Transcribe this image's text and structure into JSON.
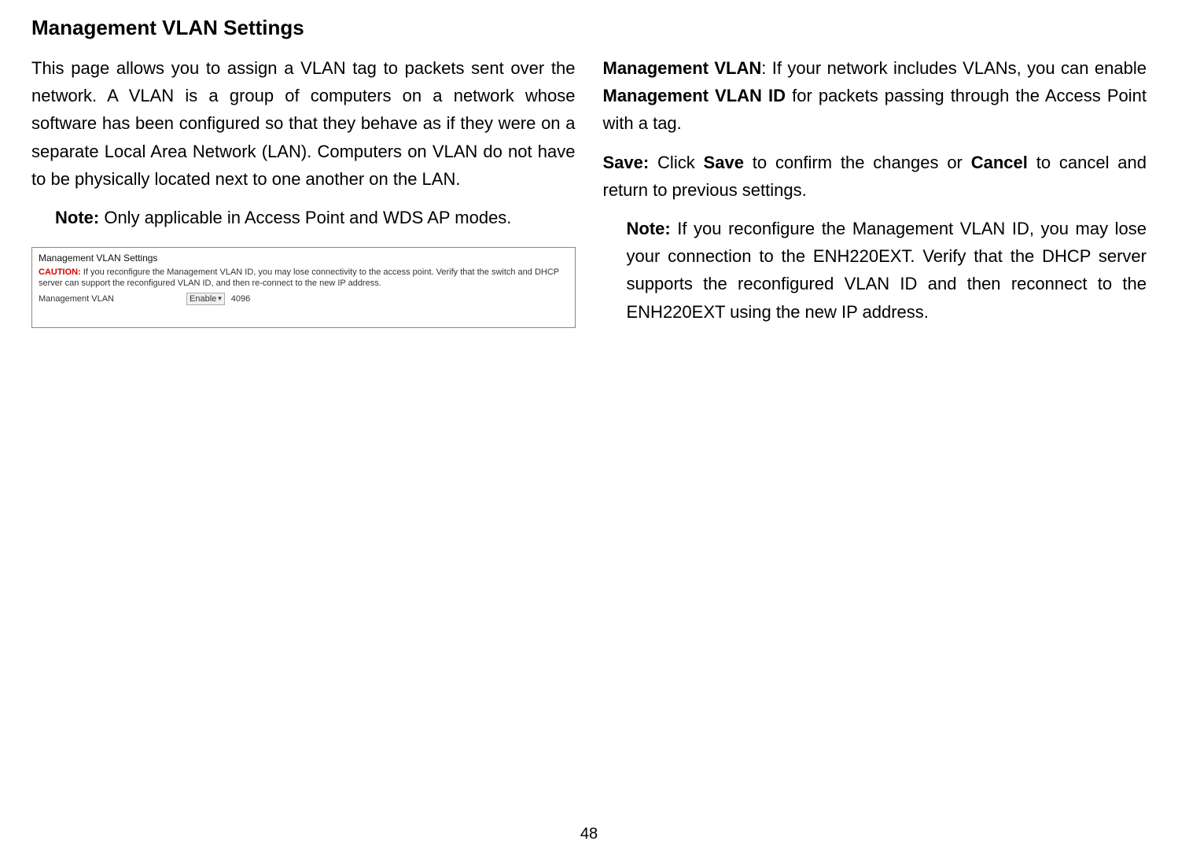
{
  "page": {
    "title": "Management VLAN Settings",
    "number": "48"
  },
  "left_col": {
    "intro": "This page allows you to assign a VLAN tag to packets sent over the network. A VLAN is a group of computers on a network whose software has been configured so that they behave as if they were on a separate Local Area Network (LAN). Computers on VLAN do not have to be physically located next to one another on the LAN.",
    "note_label": "Note:",
    "note_text": " Only applicable in Access Point and WDS AP modes."
  },
  "settings_box": {
    "title": "Management VLAN Settings",
    "caution_label": "CAUTION:",
    "caution_text": " If you reconfigure the Management VLAN ID, you may lose connectivity to the access point. Verify that the switch and DHCP server can support the reconfigured VLAN ID, and then re-connect to the new IP address.",
    "row_label": "Management VLAN",
    "dropdown_value": "Enable",
    "vlan_id": "4096"
  },
  "right_col": {
    "mgmt_label": "Management VLAN",
    "mgmt_text_1": ": If your network includes VLANs, you can enable ",
    "mgmt_bold": "Management VLAN ID",
    "mgmt_text_2": " for packets passing through the Access Point with a tag.",
    "save_label": "Save:",
    "save_text_1": " Click ",
    "save_bold_1": "Save",
    "save_text_2": " to confirm the changes or ",
    "save_bold_2": "Cancel",
    "save_text_3": " to cancel and return to previous settings.",
    "note2_label": "Note:",
    "note2_text": " If you reconfigure the Management VLAN ID, you may lose your connection to the ENH220EXT. Verify that the DHCP server supports the reconfigured VLAN ID and then reconnect to the ENH220EXT using the new IP address."
  }
}
